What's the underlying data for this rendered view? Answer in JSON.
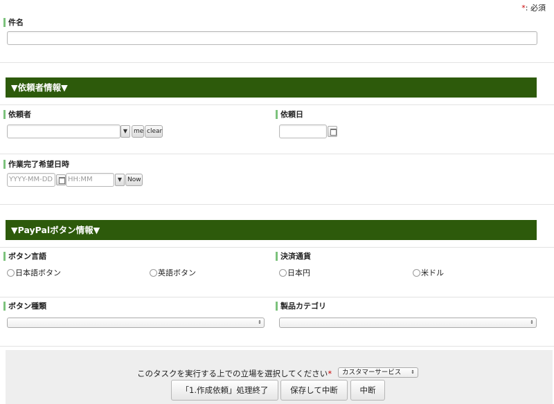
{
  "required_note": {
    "star": "*",
    "text": ": 必須"
  },
  "subject": {
    "label": "件名",
    "value": ""
  },
  "requester_section": {
    "title": "▼依頼者情報▼"
  },
  "requester": {
    "label": "依頼者",
    "value": "",
    "me_label": "me",
    "clear_label": "clear"
  },
  "request_date": {
    "label": "依頼日",
    "value": ""
  },
  "completion": {
    "label": "作業完了希望日時",
    "date_placeholder": "YYYY-MM-DD",
    "time_placeholder": "HH:MM",
    "now_label": "Now"
  },
  "paypal_section": {
    "title": "▼PayPalボタン情報▼"
  },
  "button_language": {
    "label": "ボタン言語",
    "options": [
      "日本語ボタン",
      "英語ボタン"
    ]
  },
  "currency": {
    "label": "決済通貨",
    "options": [
      "日本円",
      "米ドル"
    ]
  },
  "button_type": {
    "label": "ボタン種類",
    "value": ""
  },
  "product_category": {
    "label": "製品カテゴリ",
    "value": ""
  },
  "footer": {
    "prompt": "このタスクを実行する上での立場を選択してください",
    "required_star": "*",
    "role_selected": "カスタマーサービス",
    "buttons": [
      "「1.作成依頼」処理終了",
      "保存して中断",
      "中断"
    ]
  },
  "icons": {
    "dropdown": "chevron-down-icon",
    "calendar": "calendar-icon",
    "select_arrows": "updown-arrows-icon"
  }
}
